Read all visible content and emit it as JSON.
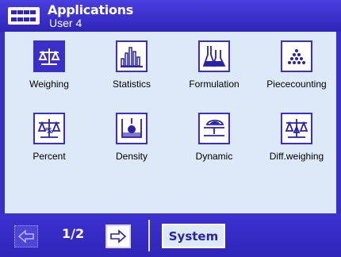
{
  "header": {
    "title": "Applications",
    "subtitle": "User 4"
  },
  "apps": [
    {
      "label": "Weighing",
      "icon": "balance-scale-icon",
      "selected": true
    },
    {
      "label": "Statistics",
      "icon": "bar-chart-icon",
      "selected": false
    },
    {
      "label": "Formulation",
      "icon": "flask-icon",
      "selected": false
    },
    {
      "label": "Piececounting",
      "icon": "pieces-pile-icon",
      "selected": false
    },
    {
      "label": "Percent",
      "icon": "percent-scale-icon",
      "selected": false
    },
    {
      "label": "Density",
      "icon": "beaker-icon",
      "selected": false
    },
    {
      "label": "Dynamic",
      "icon": "dynamic-scale-icon",
      "selected": false
    },
    {
      "label": "Diff.weighing",
      "icon": "delta-scale-icon",
      "selected": false
    }
  ],
  "footer": {
    "page_indicator": "1/2",
    "system_label": "System"
  },
  "colors": {
    "primary": "#3a2fc9",
    "background": "#dde9f8",
    "text": "#000000"
  }
}
